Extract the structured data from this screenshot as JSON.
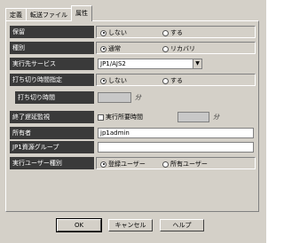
{
  "tabs": [
    {
      "label": "定義"
    },
    {
      "label": "転送ファイル"
    },
    {
      "label": "属性"
    }
  ],
  "rows": {
    "hold": {
      "label": "保留",
      "options": [
        "しない",
        "する"
      ],
      "selected": 0
    },
    "type": {
      "label": "種別",
      "options": [
        "通常",
        "リカバリ"
      ],
      "selected": 0
    },
    "exec_service": {
      "label": "実行先サービス",
      "value": "JP1/AJS2"
    },
    "timeout_setting": {
      "label": "打ち切り時間指定",
      "options": [
        "しない",
        "する"
      ],
      "selected": 0
    },
    "timeout_time": {
      "label": "打ち切り時間",
      "value": "",
      "unit": "分"
    },
    "end_delay": {
      "label": "終了遅延監視",
      "checkbox_label": "実行所要時間",
      "checked": false,
      "value": "",
      "unit": "分"
    },
    "owner": {
      "label": "所有者",
      "value": "jp1admin"
    },
    "jp1_group": {
      "label": "JP1資源グループ",
      "value": ""
    },
    "exec_user": {
      "label": "実行ユーザー種別",
      "options": [
        "登録ユーザー",
        "所有ユーザー"
      ],
      "selected": 0
    }
  },
  "buttons": {
    "ok": "OK",
    "cancel": "キャンセル",
    "help": "ヘルプ"
  }
}
